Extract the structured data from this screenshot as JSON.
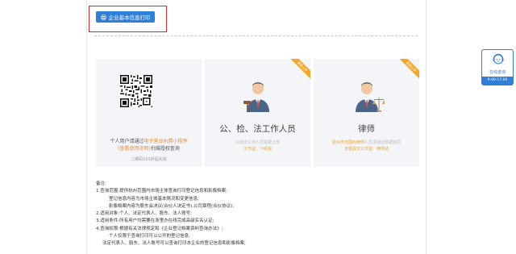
{
  "print_button": {
    "label": "企业基本信息打印"
  },
  "qr_card": {
    "line1_pre": "个人用户请通过",
    "line1_link": "电子营业执照小程序",
    "line2_link": "(查看使用说明)",
    "line2_post": "扫描授权查询",
    "expire": "二维码161秒后失效"
  },
  "official_card": {
    "ribbon": "需要上传",
    "title": "公、检、法工作人员",
    "desc1": "公检法工作人员需要上传",
    "desc2": "工作证、介绍信"
  },
  "lawyer_card": {
    "ribbon": "需要上传",
    "title": "律师",
    "desc1_orange": "杭州市范围内律师",
    "desc1_grey": "人员须通过数据协同",
    "desc2": "无需提交工作证、律师证"
  },
  "notes": [
    {
      "indent": 0,
      "text": "备注:"
    },
    {
      "indent": 0,
      "text": "1.查询范围:提供杭州范围内市场主体查询打印登记信息和影像档案;"
    },
    {
      "indent": 1,
      "text": "登记信息内容为市场主体基本情况和变更信息;"
    },
    {
      "indent": 1,
      "text": "影像档案内容为股东会决议(合伙人决定书),公司章程(合伙协议);"
    },
    {
      "indent": 0,
      "text": "2.适用对象:个人、法定代表人、股东、法人账号;"
    },
    {
      "indent": 0,
      "text": "3.适用条件:所有用户均需要在浙里办在线完成高级实名认证;"
    },
    {
      "indent": 0,
      "text": "4.查询权限:根据有关法律规定和《企业登记档案资料查询办法》:"
    },
    {
      "indent": 1,
      "text": "个人仅限于查询打印可以公开的登记信息;"
    },
    {
      "indent": 1,
      "text": "法定代表人、股东、法人账号可以查询打印本企业的登记信息和影像档案;"
    }
  ],
  "customer_service": {
    "label": "在线咨询",
    "hours": "9:00-17:00"
  },
  "colors": {
    "accent": "#2f7ed8",
    "highlight_box": "#d9272e",
    "orange": "#f28c28",
    "ribbon": "#f5a623"
  }
}
